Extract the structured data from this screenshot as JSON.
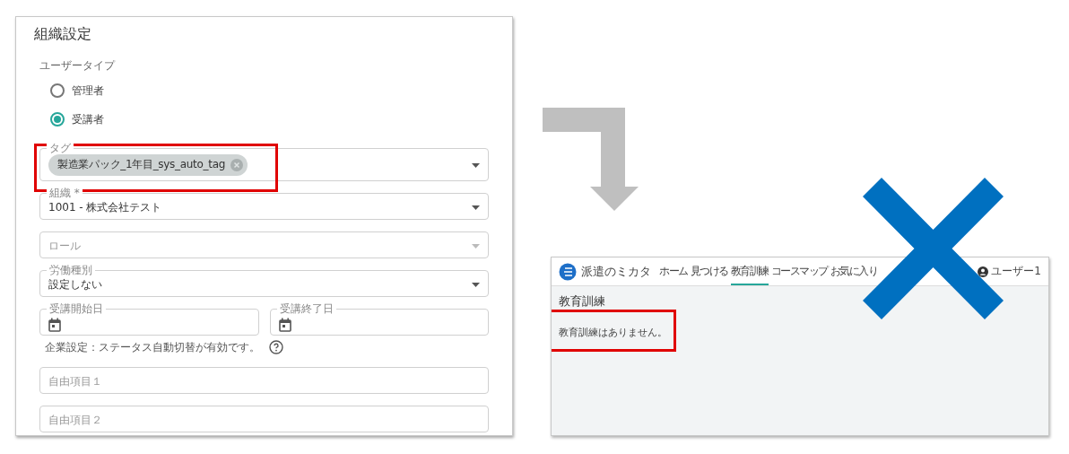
{
  "settings_form": {
    "title": "組織設定",
    "user_type": {
      "label": "ユーザータイプ",
      "options": [
        {
          "label": "管理者",
          "selected": false
        },
        {
          "label": "受講者",
          "selected": true
        }
      ]
    },
    "tag_field": {
      "label": "タグ",
      "chips": [
        "製造業パック_1年目_sys_auto_tag"
      ],
      "highlighted": true
    },
    "organization_field": {
      "label": "組織 *",
      "value": "1001 - 株式会社テスト"
    },
    "role_field": {
      "placeholder": "ロール"
    },
    "labor_type_field": {
      "label": "労働種別",
      "value": "設定しない"
    },
    "date_fields": [
      {
        "label": "受講開始日"
      },
      {
        "label": "受講終了日"
      }
    ],
    "note": "企業設定：ステータス自動切替が有効です。",
    "free_fields": [
      {
        "placeholder": "自由項目１"
      },
      {
        "placeholder": "自由項目２"
      }
    ]
  },
  "result_screen": {
    "logo_text": "派遣のミカタ",
    "nav_items": [
      {
        "label": "ホーム",
        "selected": false
      },
      {
        "label": "見つける",
        "selected": false
      },
      {
        "label": "教育訓練",
        "selected": true
      },
      {
        "label": "コースマップ",
        "selected": false
      },
      {
        "label": "お気に入り",
        "selected": false
      }
    ],
    "user_label": "ユーザー1",
    "page_title": "教育訓練",
    "empty_message": "教育訓練はありません。",
    "message_highlighted": true,
    "crossed_out": true
  }
}
